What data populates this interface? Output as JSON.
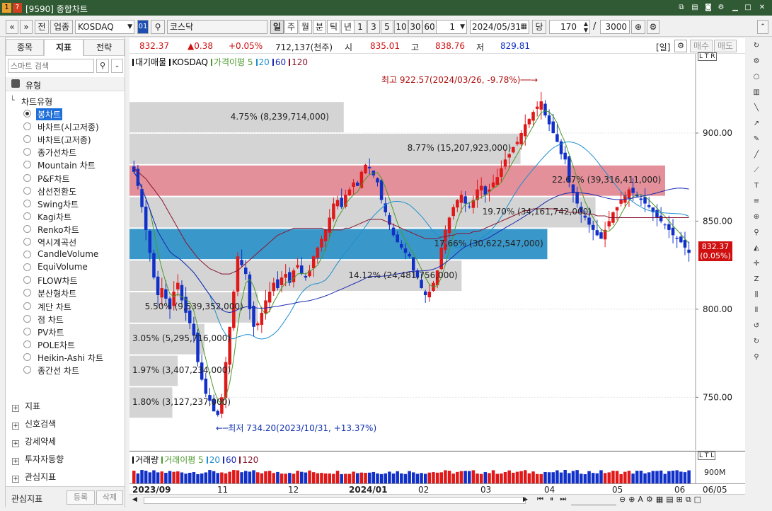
{
  "window": {
    "title": "[9590] 종합차트",
    "badge1": "1",
    "badge2": "?"
  },
  "toolbar": {
    "prev": "«",
    "next": "»",
    "jeon": "전",
    "market": "업종",
    "symbol": "KOSDAQ",
    "code_btn": "01",
    "name": "코스닥",
    "periods": [
      "일",
      "주",
      "월",
      "분",
      "틱",
      "년"
    ],
    "intervals": [
      "1",
      "3",
      "5",
      "10",
      "30",
      "60"
    ],
    "count": "1",
    "date": "2024/05/31",
    "dang": "당",
    "bars": "170",
    "slash": "/",
    "total": "3000"
  },
  "tabs": [
    "종목",
    "지표",
    "전략"
  ],
  "search": {
    "placeholder": "스마트 검색"
  },
  "tree": {
    "type_header": "유형",
    "group": "차트유형",
    "items": [
      "봉차트",
      "바차트(시고저종)",
      "바차트(고저종)",
      "종가선차트",
      "Mountain 차트",
      "P&F차트",
      "삼선전환도",
      "Swing차트",
      "Kagi차트",
      "Renko차트",
      "역시계곡선",
      "CandleVolume",
      "EquiVolume",
      "FLOW차트",
      "분산형차트",
      "계단 차트",
      "점 차트",
      "PV차트",
      "POLE차트",
      "Heikin-Ashi 차트",
      "종간선 차트"
    ],
    "selected_index": 0
  },
  "sections": [
    "지표",
    "신호검색",
    "강세약세",
    "투자자동향",
    "관심지표"
  ],
  "bottom": {
    "label": "관심지표",
    "register": "등록",
    "delete": "삭제"
  },
  "pricebar": {
    "price": "832.37",
    "change": "▲0.38",
    "pct": "+0.05%",
    "volume": "712,137(천주)",
    "open_label": "시",
    "open": "835.01",
    "high_label": "고",
    "high": "838.76",
    "low_label": "저",
    "low": "829.81",
    "period_tag": "[일]",
    "buy": "매수",
    "sell": "매도"
  },
  "legend": {
    "items": [
      {
        "text": "대기매물",
        "color": "#000000"
      },
      {
        "text": "KOSDAQ",
        "color": "#000000"
      },
      {
        "text": "가격이평 5",
        "color": "#4a9a2a"
      },
      {
        "text": "20",
        "color": "#1e8fd0"
      },
      {
        "text": "60",
        "color": "#1a2ab0"
      },
      {
        "text": "120",
        "color": "#8a1530"
      }
    ],
    "corner": "L T R"
  },
  "annotations": {
    "high": "최고 922.57(2024/03/26, -9.78%)",
    "low": "최저 734.20(2023/10/31, +13.37%)",
    "current": "832.37",
    "current_pct": "(0.05%)"
  },
  "volume_legend": {
    "items": [
      {
        "text": "거래량",
        "color": "#000000"
      },
      {
        "text": "거래이평 5",
        "color": "#4a9a2a"
      },
      {
        "text": "20",
        "color": "#1e8fd0"
      },
      {
        "text": "60",
        "color": "#1a2ab0"
      },
      {
        "text": "120",
        "color": "#8a1530"
      }
    ],
    "axis": "900M",
    "corner": "L T L"
  },
  "xaxis": {
    "labels": [
      "2023/09",
      "11",
      "12",
      "2024/01",
      "02",
      "03",
      "04",
      "05",
      "06"
    ],
    "right": "06/05"
  },
  "chart_data": {
    "type": "candlestick",
    "y_ticks": [
      750,
      800,
      850,
      900
    ],
    "ylim": [
      720,
      945
    ],
    "volume_profile": [
      {
        "low": 900,
        "high": 918,
        "pct": "4.75%",
        "vol": "(8,239,714,000)",
        "frac": 0.4
      },
      {
        "low": 882,
        "high": 900,
        "pct": "8.77%",
        "vol": "(15,207,923,000)",
        "frac": 0.73
      },
      {
        "low": 864,
        "high": 882,
        "pct": "22.67%",
        "vol": "(39,316,411,000)",
        "frac": 1.0,
        "color": "#e3909a"
      },
      {
        "low": 846,
        "high": 864,
        "pct": "19.70%",
        "vol": "(34,161,742,000)",
        "frac": 0.87
      },
      {
        "low": 828,
        "high": 846,
        "pct": "17.66%",
        "vol": "(30,622,547,000)",
        "frac": 0.78,
        "color": "#3a97c9"
      },
      {
        "low": 810,
        "high": 828,
        "pct": "14.12%",
        "vol": "(24,481,756,000)",
        "frac": 0.62
      },
      {
        "low": 792,
        "high": 810,
        "pct": "5.50%",
        "vol": "(9,539,352,000)",
        "frac": 0.24
      },
      {
        "low": 774,
        "high": 792,
        "pct": "3.05%",
        "vol": "(5,295,716,000)",
        "frac": 0.14
      },
      {
        "low": 756,
        "high": 774,
        "pct": "1.97%",
        "vol": "(3,407,234,000)",
        "frac": 0.09
      },
      {
        "low": 738,
        "high": 756,
        "pct": "1.80%",
        "vol": "(3,127,237,000)",
        "frac": 0.08
      }
    ],
    "closes": [
      878,
      870,
      858,
      845,
      832,
      818,
      808,
      812,
      806,
      800,
      810,
      815,
      805,
      798,
      792,
      785,
      770,
      760,
      752,
      748,
      742,
      740,
      750,
      770,
      790,
      810,
      830,
      825,
      820,
      800,
      790,
      792,
      798,
      805,
      810,
      815,
      812,
      818,
      820,
      815,
      822,
      825,
      820,
      818,
      822,
      830,
      835,
      840,
      845,
      852,
      860,
      862,
      858,
      865,
      868,
      872,
      870,
      878,
      882,
      880,
      876,
      872,
      862,
      855,
      848,
      842,
      838,
      835,
      832,
      830,
      822,
      818,
      812,
      808,
      810,
      815,
      822,
      835,
      845,
      852,
      858,
      862,
      865,
      860,
      858,
      862,
      868,
      870,
      865,
      868,
      872,
      875,
      880,
      885,
      888,
      892,
      895,
      900,
      905,
      908,
      912,
      915,
      918,
      910,
      905,
      900,
      895,
      888,
      885,
      872,
      866,
      860,
      855,
      852,
      848,
      845,
      842,
      840,
      845,
      850,
      855,
      858,
      862,
      865,
      868,
      866,
      864,
      862,
      860,
      858,
      855,
      852,
      850,
      848,
      845,
      842,
      840,
      838,
      835,
      832
    ],
    "ma120": [
      880,
      878,
      876,
      874,
      871,
      868,
      865,
      862,
      858,
      854,
      850,
      846,
      842,
      838,
      835,
      832,
      829,
      827,
      825,
      823,
      822,
      821,
      820,
      820,
      820,
      821,
      822,
      824,
      826,
      828,
      830,
      832,
      834,
      836,
      838,
      840,
      842,
      843,
      844,
      845,
      846,
      846,
      846,
      846,
      846,
      846,
      846,
      846,
      845,
      845,
      845,
      845,
      845,
      846,
      846,
      847,
      848,
      849,
      850,
      851,
      851,
      851,
      851,
      850,
      849,
      848,
      847,
      846,
      845,
      844,
      843,
      842,
      841,
      840,
      840,
      840,
      840,
      841,
      841,
      842,
      842,
      843,
      843,
      843,
      843,
      844,
      844,
      845,
      846,
      847,
      848,
      849,
      850,
      851,
      852,
      853,
      854,
      855,
      856,
      856,
      857,
      857,
      857,
      857,
      857,
      857,
      856,
      856,
      856,
      855,
      855,
      855,
      855,
      854,
      854,
      854,
      853,
      853,
      853,
      852,
      852,
      852,
      852,
      852,
      852,
      852,
      852,
      852,
      852,
      852,
      852,
      852,
      852,
      852,
      852,
      852,
      852,
      852,
      852,
      852
    ]
  }
}
